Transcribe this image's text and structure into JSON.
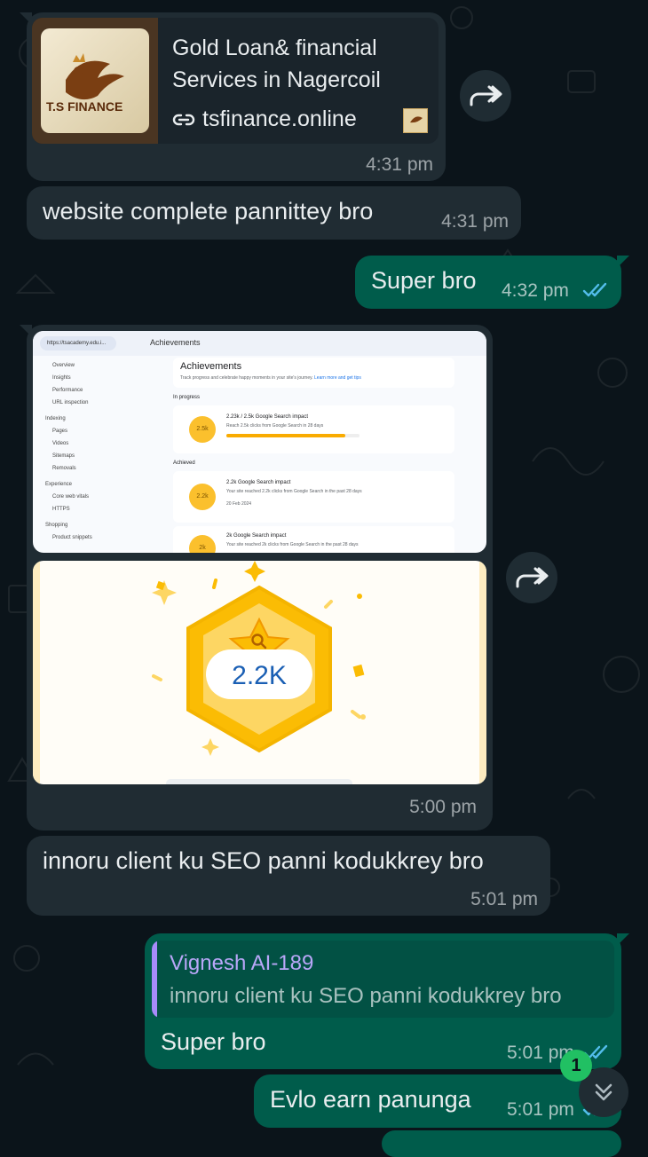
{
  "colors": {
    "background": "#0b141a",
    "incoming_bubble": "#202c33",
    "outgoing_bubble": "#005c4b",
    "read_tick": "#53bdeb",
    "unread_badge": "#21c063"
  },
  "messages": [
    {
      "type": "link-preview",
      "direction": "incoming",
      "preview_title": "Gold Loan& financial Services in Nagercoil",
      "preview_url": "tsfinance.online",
      "logo_text": "T.S FINANCE",
      "time": "4:31 pm",
      "forward_icon": "forward-icon"
    },
    {
      "type": "text",
      "direction": "incoming",
      "text": "website complete pannittey bro",
      "time": "4:31 pm"
    },
    {
      "type": "text",
      "direction": "outgoing",
      "text": "Super bro",
      "time": "4:32 pm",
      "status": "read"
    },
    {
      "type": "image-group",
      "direction": "incoming",
      "time": "5:00 pm",
      "forward_icon": "forward-icon",
      "screenshot": {
        "url_bar": "https://tsacademy.edu.i...",
        "page_heading": "Achievements",
        "card_title": "Achievements",
        "card_subtitle": "Track progress and celebrate happy moments in your site's journey.",
        "card_link": "Learn more and get tips",
        "in_progress_label": "In progress",
        "achieved_label": "Achieved",
        "nav_items": [
          "Overview",
          "Insights",
          "Performance",
          "URL inspection",
          "Indexing",
          "Pages",
          "Videos",
          "Sitemaps",
          "Removals",
          "Experience",
          "Core web vitals",
          "HTTPS",
          "Shopping",
          "Product snippets"
        ],
        "items": [
          {
            "badge": "2.5k",
            "title": "2.23k / 2.5k Google Search impact",
            "desc": "Reach 2.5k clicks from Google Search in 28 days",
            "progress": 0.89
          },
          {
            "badge": "2.2k",
            "title": "2.2k Google Search impact",
            "desc": "Your site reached 2.2k clicks from Google Search in the past 28 days",
            "date": "20 Feb 2024"
          },
          {
            "badge": "2k",
            "title": "2k Google Search impact",
            "desc": "Your site reached 2k clicks from Google Search in the past 28 days"
          }
        ]
      },
      "badge_image": {
        "value": "2.2K",
        "icon": "search-icon"
      }
    },
    {
      "type": "text",
      "direction": "incoming",
      "text": "innoru client ku SEO panni kodukkrey bro",
      "time": "5:01 pm"
    },
    {
      "type": "reply",
      "direction": "outgoing",
      "quote_author": "Vignesh AI-189",
      "quote_text": "innoru client ku SEO panni kodukkrey bro",
      "text": "Super bro",
      "time": "5:01 pm",
      "status": "read"
    },
    {
      "type": "text",
      "direction": "outgoing",
      "text": "Evlo earn panunga",
      "time": "5:01 pm",
      "status": "read"
    }
  ],
  "scroll_button": {
    "icon": "double-chevron-down-icon",
    "unread_count": "1"
  }
}
